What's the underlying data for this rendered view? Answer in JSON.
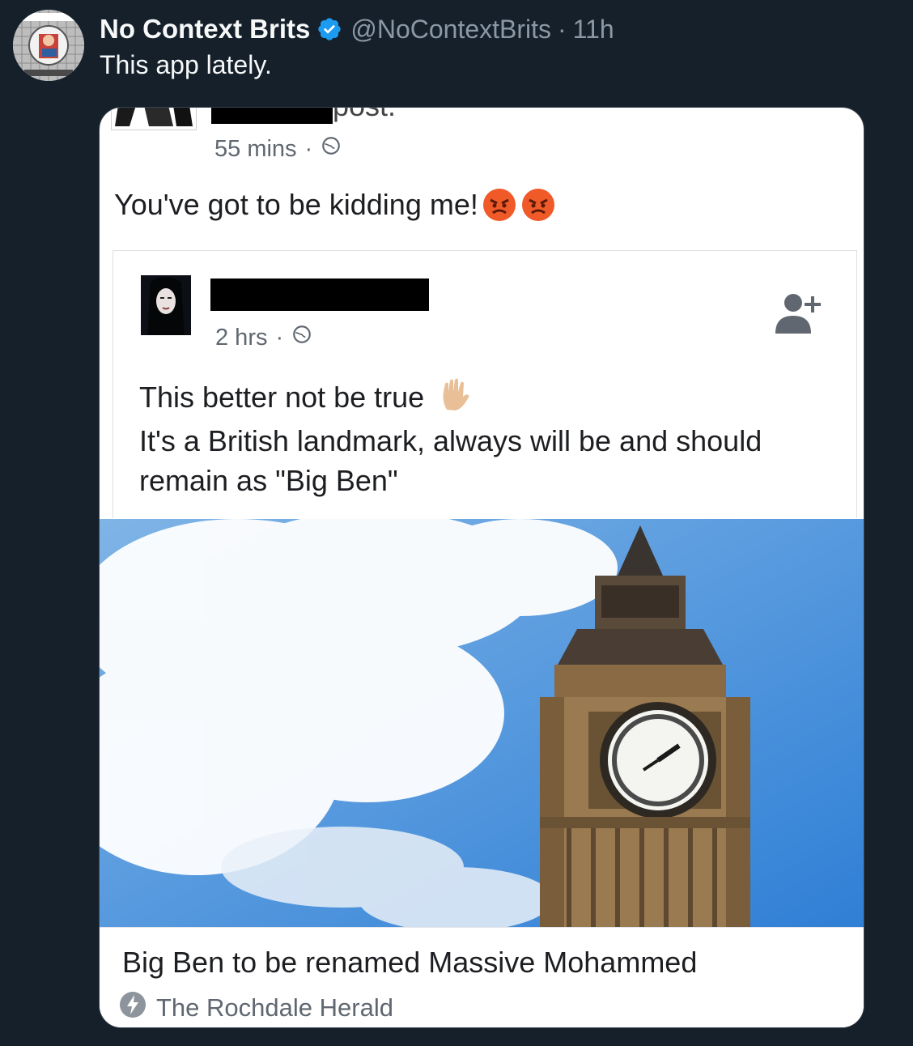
{
  "tweet": {
    "display_name": "No Context Brits",
    "handle": "@NoContextBrits",
    "separator": "·",
    "time": "11h",
    "text": "This app lately.",
    "verified_icon": "verified-badge-icon",
    "colors": {
      "background": "#15202b",
      "verified": "#1d9bf0",
      "muted": "#8b98a5"
    }
  },
  "screenshot": {
    "top_post": {
      "cut_off_text": "post.",
      "time": "55 mins",
      "separator": "·",
      "privacy_icon": "globe-icon",
      "text": "You've got to be kidding me!",
      "emojis": [
        "angry-face-icon",
        "angry-face-icon"
      ]
    },
    "shared_post": {
      "time": "2 hrs",
      "separator": "·",
      "privacy_icon": "globe-icon",
      "add_friend_icon": "add-friend-icon",
      "line1": "This better not be true",
      "line1_emoji": "raised-hand-icon",
      "line2": "It's a British landmark, always will be and should",
      "line3": "remain as \"Big Ben\""
    },
    "link": {
      "title": "Big Ben to be renamed Massive Mohammed",
      "source": "The Rochdale Herald",
      "source_icon": "lightning-bolt-icon"
    }
  }
}
